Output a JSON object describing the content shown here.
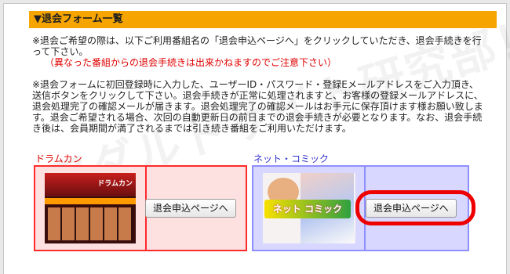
{
  "section": {
    "title": "▼退会フォーム一覧"
  },
  "instructions": {
    "line1": "※退会ご希望の際は、以下ご利用番組名の「退会申込ページへ」をクリックしていただき、退会手続きを行って下さい。",
    "notice": "（異なった番組からの退会手続きは出来かねますのでご注意下さい）",
    "line2": "※退会フォームに初回登録時に入力した、ユーザーID・パスワード・登録Eメールアドレスをご入力頂き、送信ボタンをクリックして下さい。退会手続きが正常に処理されますと、お客様の登録メールアドレスに、退会処理完了の確認メールが届きます。退会処理完了の確認メールはお手元に保存頂けます様お願い致します。退会ご希望される場合、次回の自動更新日の前日までの退会手続きが必要となります。なお、退会手続き後は、会員期間が満了されるまでは引き続き番組をご利用いただけます。"
  },
  "watermark": "アダルトサイト研究部！",
  "services": [
    {
      "name": "ドラムカン",
      "thumb_text": "ドラムカン",
      "button": "退会申込ページへ"
    },
    {
      "name": "ネット・コミック",
      "thumb_text": "ネット コミック",
      "button": "退会申込ページへ"
    }
  ],
  "colors": {
    "header_bg": "#f5a400",
    "notice_text": "#e00000",
    "doramkan_border": "#ff2a2a",
    "netcomic_border": "#8f8fff",
    "highlight": "#ee0000"
  }
}
